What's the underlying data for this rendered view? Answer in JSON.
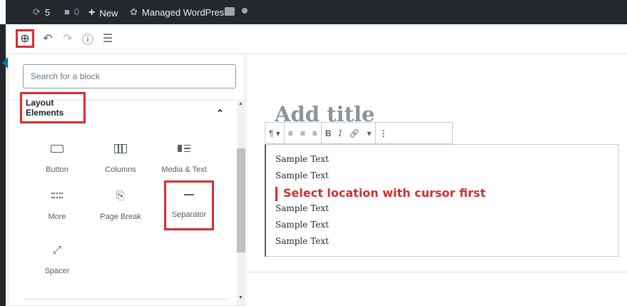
{
  "admin_bar": {
    "updates_count": "5",
    "comments_count": "0",
    "new_label": "New",
    "managed_label": "Managed WordPress"
  },
  "toolbar": {
    "inserter_icon": "plus-circle-icon",
    "undo_icon": "undo-icon",
    "redo_icon": "redo-icon",
    "info_icon": "info-icon",
    "nav_icon": "block-navigation-icon"
  },
  "inserter": {
    "search_placeholder": "Search for a block",
    "panel_title": "Layout Elements",
    "blocks": [
      {
        "label": "Button",
        "icon": "button-icon"
      },
      {
        "label": "Columns",
        "icon": "columns-icon"
      },
      {
        "label": "Media & Text",
        "icon": "media-text-icon"
      },
      {
        "label": "More",
        "icon": "more-icon"
      },
      {
        "label": "Page Break",
        "icon": "page-break-icon"
      },
      {
        "label": "Separator",
        "icon": "separator-icon"
      },
      {
        "label": "Spacer",
        "icon": "spacer-icon"
      }
    ]
  },
  "editor": {
    "title_placeholder": "Add title",
    "lines_before": [
      "Sample Text",
      "Sample Text"
    ],
    "cursor_note": "Select location with cursor first",
    "lines_after": [
      "Sample Text",
      "Sample Text",
      "Sample Text"
    ]
  },
  "colors": {
    "admin_bar": "#23282d",
    "highlight": "#d32f2f",
    "accent": "#0073aa"
  }
}
